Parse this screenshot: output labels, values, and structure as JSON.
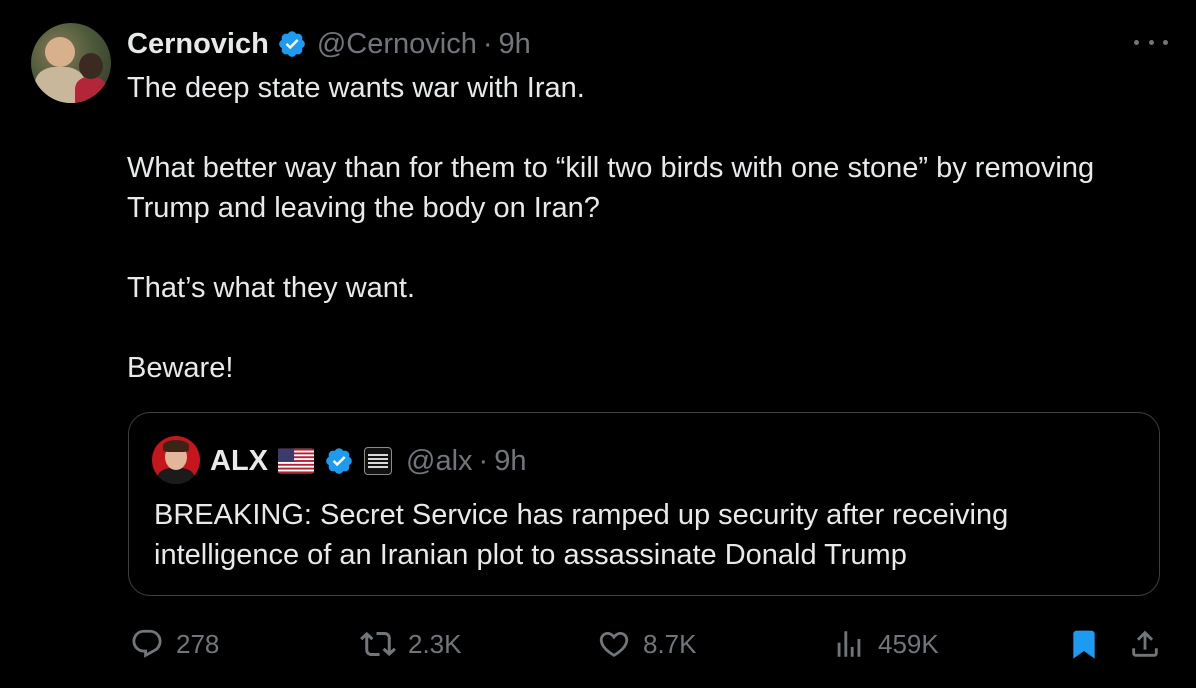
{
  "tweet": {
    "author": {
      "name": "Cernovich",
      "handle": "@Cernovich",
      "time": "9h",
      "separator": "·",
      "verified": true
    },
    "paragraphs": [
      "The deep state wants war with Iran.",
      "What better way than for them to “kill two birds with one stone” by removing Trump and leaving the body on Iran?",
      "That’s what they want.",
      "Beware!"
    ],
    "quote": {
      "name": "ALX",
      "handle": "@alx",
      "separator": "·",
      "time": "9h",
      "verified": true,
      "text": "BREAKING: Secret Service has ramped up security after receiving intelligence of an Iranian plot to assassinate Donald Trump"
    },
    "actions": {
      "replies": "278",
      "reposts": "2.3K",
      "likes": "8.7K",
      "views": "459K",
      "bookmarked": true
    }
  },
  "colors": {
    "background": "#000000",
    "text": "#e7e9ea",
    "muted": "#71767b",
    "verified": "#1d9bf0",
    "border": "#3b3f44",
    "bookmark": "#1d9bf0"
  },
  "icons": {
    "more": "more-horizontal-icon",
    "reply": "reply-icon",
    "repost": "repost-icon",
    "like": "heart-icon",
    "views": "views-icon",
    "bookmark": "bookmark-icon",
    "share": "share-icon",
    "verified": "verified-badge-icon",
    "flag": "us-flag-icon"
  }
}
